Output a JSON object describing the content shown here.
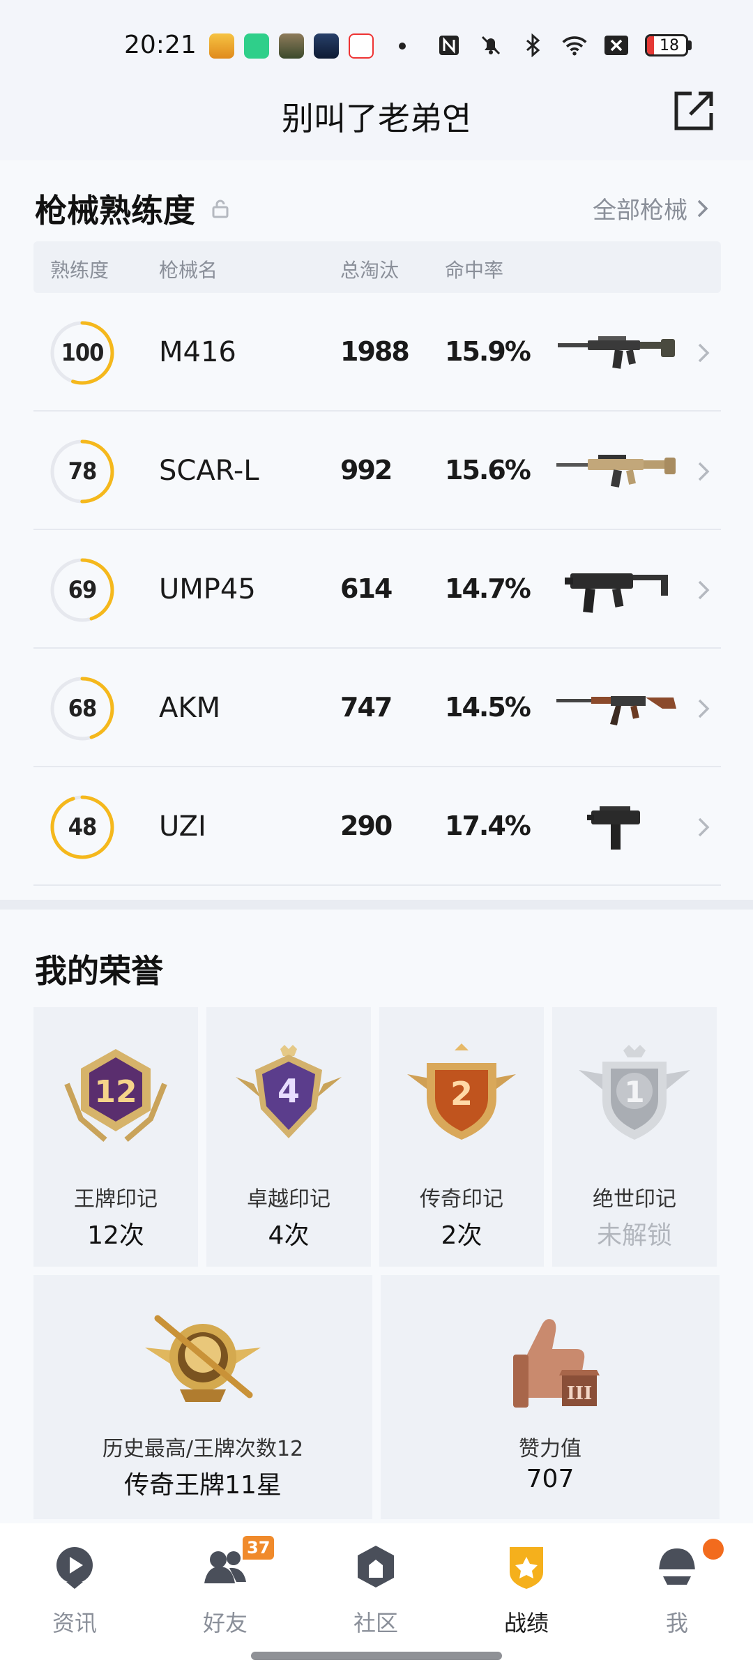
{
  "status_bar": {
    "time": "20:21",
    "battery_level": "18",
    "battery_fraction": 0.18
  },
  "header": {
    "title": "别叫了老弟연",
    "share_icon": "share-icon"
  },
  "gun_section": {
    "title": "枪械熟练度",
    "all_link": "全部枪械",
    "columns": [
      "熟练度",
      "枪械名",
      "总淘汰",
      "命中率"
    ],
    "rows": [
      {
        "mastery": "100",
        "mastery_fraction": 0.55,
        "name": "M416",
        "kills": "1988",
        "accuracy": "15.9%"
      },
      {
        "mastery": "78",
        "mastery_fraction": 0.5,
        "name": "SCAR-L",
        "kills": "992",
        "accuracy": "15.6%"
      },
      {
        "mastery": "69",
        "mastery_fraction": 0.45,
        "name": "UMP45",
        "kills": "614",
        "accuracy": "14.7%"
      },
      {
        "mastery": "68",
        "mastery_fraction": 0.45,
        "name": "AKM",
        "kills": "747",
        "accuracy": "14.5%"
      },
      {
        "mastery": "48",
        "mastery_fraction": 0.95,
        "name": "UZI",
        "kills": "290",
        "accuracy": "17.4%"
      }
    ]
  },
  "honor_section": {
    "title": "我的荣誉",
    "badges": [
      {
        "label": "王牌印记",
        "count": "12次",
        "number": "12",
        "locked": false
      },
      {
        "label": "卓越印记",
        "count": "4次",
        "number": "4",
        "locked": false
      },
      {
        "label": "传奇印记",
        "count": "2次",
        "number": "2",
        "locked": false
      },
      {
        "label": "绝世印记",
        "count": "未解锁",
        "number": "1",
        "locked": true
      }
    ],
    "big_tiles": [
      {
        "label": "历史最高/王牌次数12",
        "value": "传奇王牌11星"
      },
      {
        "label": "赞力值",
        "value": "707"
      }
    ]
  },
  "bottom_nav": {
    "items": [
      {
        "label": "资讯",
        "icon": "news-play-icon"
      },
      {
        "label": "好友",
        "icon": "friends-icon",
        "badge": "37"
      },
      {
        "label": "社区",
        "icon": "community-icon"
      },
      {
        "label": "战绩",
        "icon": "record-shield-icon",
        "active": true
      },
      {
        "label": "我",
        "icon": "helmet-icon"
      }
    ]
  },
  "colors": {
    "accent": "#f5b81c",
    "ring_track": "#e6e8ee",
    "muted_text": "#8a8f99",
    "badge_orange": "#f08a2b"
  }
}
